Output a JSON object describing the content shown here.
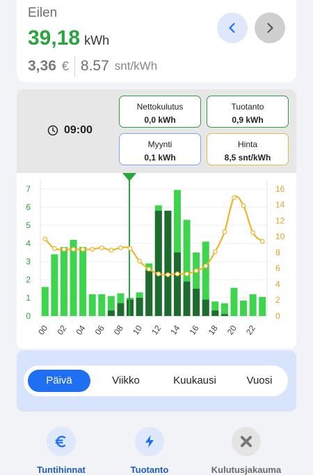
{
  "summary": {
    "day_label": "Eilen",
    "kwh_value": "39,18",
    "kwh_unit": "kWh",
    "eur_value": "3,36",
    "eur_unit": "€",
    "snt_value": "8.57",
    "snt_unit": "snt/kWh",
    "prev_icon": "chevron-left-icon",
    "next_icon": "chevron-right-icon"
  },
  "info": {
    "clock_icon": "clock-icon",
    "time": "09:00",
    "net": {
      "title": "Nettokulutus",
      "value": "0,0 kWh"
    },
    "production": {
      "title": "Tuotanto",
      "value": "0,9 kWh"
    },
    "sold": {
      "title": "Myynti",
      "value": "0,1 kWh"
    },
    "price": {
      "title": "Hinta",
      "value": "8,5 snt/kWh"
    }
  },
  "colors": {
    "green_accent": "#2aa43d",
    "production_bar": "#3fd44d",
    "consumption_bar": "#1d6b2f",
    "price_line": "#f0b429",
    "primary_blue": "#1f6ff2",
    "net_border": "#2e9b44",
    "sold_border": "#7fa7e8",
    "price_border": "#e8b84a"
  },
  "chart_data": {
    "type": "bar",
    "hours": [
      0,
      1,
      2,
      3,
      4,
      5,
      6,
      7,
      8,
      9,
      10,
      11,
      12,
      13,
      14,
      15,
      16,
      17,
      18,
      19,
      20,
      21,
      22,
      23
    ],
    "x_tick_labels": [
      "00",
      "02",
      "04",
      "06",
      "08",
      "10",
      "12",
      "14",
      "16",
      "18",
      "20",
      "22"
    ],
    "left_axis": {
      "ticks": [
        0,
        1,
        2,
        3,
        4,
        5,
        6,
        7
      ],
      "ylim": [
        0,
        7.5
      ]
    },
    "right_axis": {
      "ticks": [
        0,
        2,
        4,
        6,
        8,
        10,
        12,
        14,
        16
      ],
      "ylim": [
        0,
        17.14
      ]
    },
    "selected_hour": 9,
    "series": [
      {
        "name": "",
        "kind": "bar-light",
        "values": [
          1.6,
          3.4,
          3.8,
          4.2,
          3.8,
          1.2,
          1.2,
          1.1,
          1.25,
          1.0,
          1.3,
          2.9,
          6.1,
          5.8,
          6.95,
          5.3,
          3.5,
          4.1,
          0.8,
          0.7,
          1.55,
          0.85,
          1.2,
          1.05
        ]
      },
      {
        "name": "",
        "kind": "bar-dark",
        "values": [
          0,
          0,
          0,
          0,
          0,
          0,
          0,
          0.3,
          0.7,
          0.9,
          1.0,
          2.5,
          5.8,
          5.8,
          3.5,
          1.9,
          1.5,
          0.9,
          0.3,
          0.1,
          0,
          0,
          0,
          0
        ]
      },
      {
        "name": "",
        "kind": "line",
        "values": [
          9.7,
          8.5,
          8.4,
          8.4,
          8.4,
          8.4,
          8.6,
          8.3,
          8.6,
          8.5,
          6.9,
          5.9,
          5.3,
          5.2,
          5.3,
          5.3,
          5.7,
          6.3,
          8.1,
          10.6,
          14.9,
          13.9,
          10.5,
          9.4
        ]
      }
    ]
  },
  "period": {
    "tabs": [
      "Päivä",
      "Viikko",
      "Kuukausi",
      "Vuosi"
    ],
    "active": "Päivä"
  },
  "bottom_nav": [
    {
      "label": "Tuntihinnat",
      "icon": "euro-icon",
      "color": "#1f5cc4"
    },
    {
      "label": "Tuotanto",
      "icon": "bolt-icon",
      "color": "#1f5cc4"
    },
    {
      "label": "Kulutusjakauma",
      "icon": "cross-icon",
      "color": "#6b6b6b"
    }
  ]
}
